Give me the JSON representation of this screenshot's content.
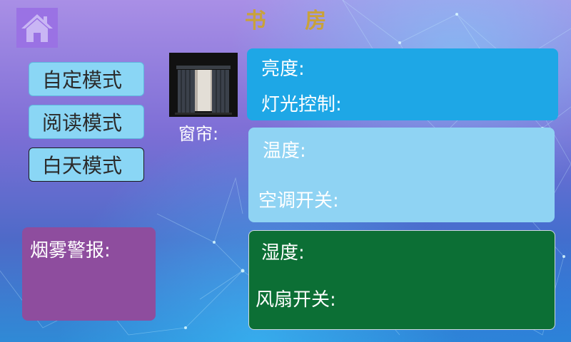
{
  "header": {
    "title": "书 房",
    "home_icon": "home-icon"
  },
  "modes": [
    {
      "label": "自定模式",
      "active": false
    },
    {
      "label": "阅读模式",
      "active": false
    },
    {
      "label": "白天模式",
      "active": true
    }
  ],
  "curtain": {
    "label": "窗帘:",
    "icon": "curtain-icon"
  },
  "light_panel": {
    "brightness_label": "亮度:",
    "control_label": "灯光控制:"
  },
  "ac_panel": {
    "temperature_label": "温度:",
    "switch_label": "空调开关:"
  },
  "fan_panel": {
    "humidity_label": "湿度:",
    "switch_label": "风扇开关:"
  },
  "smoke_panel": {
    "label": "烟雾警报:"
  },
  "colors": {
    "title": "#c9a23b",
    "mode_button": "#8ad6f5",
    "light_panel": "#1ea7e6",
    "ac_panel": "#8fd3f3",
    "fan_panel": "#0c6f35",
    "smoke_panel": "#8e4d9e",
    "home_button": "#9a72e4"
  }
}
